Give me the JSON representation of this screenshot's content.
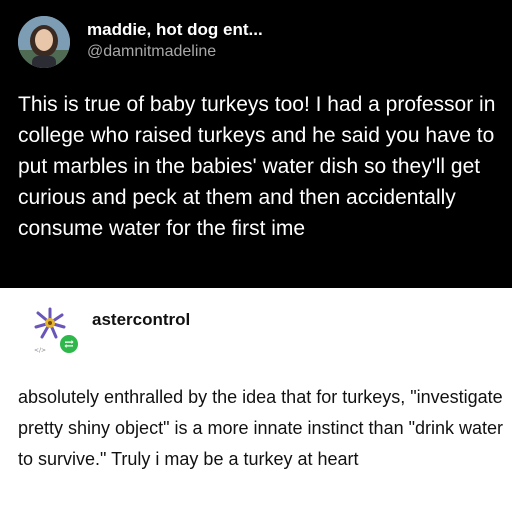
{
  "tweet": {
    "display_name": "maddie, hot dog ent...",
    "handle": "@damnitmadeline",
    "avatar_icon": "profile-photo",
    "text": "This is true of baby turkeys too! I had a professor in college who raised turkeys and he said you have to put marbles in the babies' water dish so they'll get curious and peck at them and then accidentally consume water for the first ime"
  },
  "tumblr_post": {
    "username": "astercontrol",
    "avatar_icon": "aster-flower-icon",
    "badge_icon": "reblog-icon",
    "badge_color": "#2eb84b",
    "text": "absolutely enthralled by the idea that for turkeys, \"investigate pretty shiny object\" is a more innate instinct than \"drink water to survive.\" Truly i may be a turkey at heart"
  }
}
